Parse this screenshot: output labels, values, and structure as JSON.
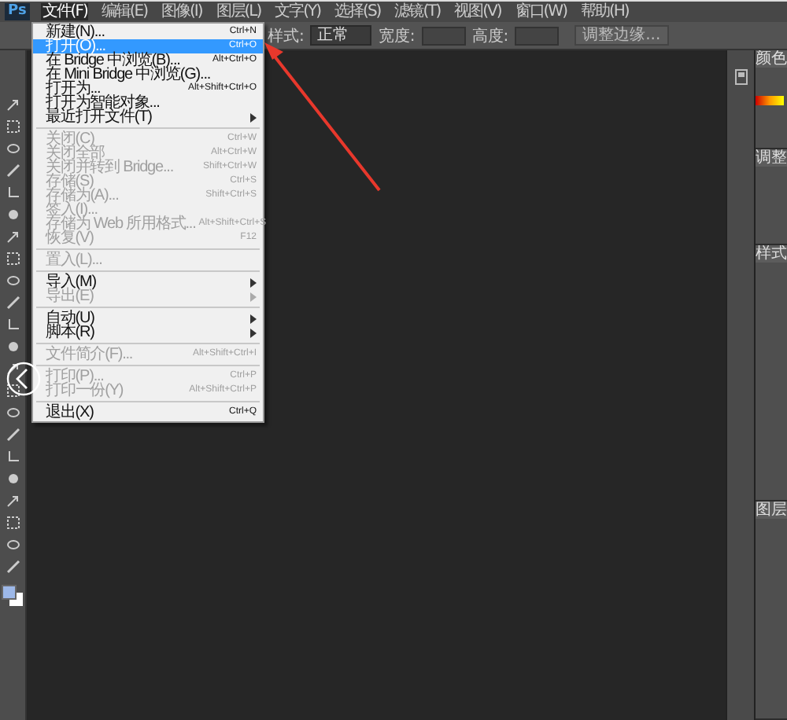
{
  "app_logo": "Ps",
  "menu_bar": [
    {
      "label": "文件(F)",
      "selected": true
    },
    {
      "label": "编辑(E)",
      "selected": false
    },
    {
      "label": "图像(I)",
      "selected": false
    },
    {
      "label": "图层(L)",
      "selected": false
    },
    {
      "label": "文字(Y)",
      "selected": false
    },
    {
      "label": "选择(S)",
      "selected": false
    },
    {
      "label": "滤镜(T)",
      "selected": false
    },
    {
      "label": "视图(V)",
      "selected": false
    },
    {
      "label": "窗口(W)",
      "selected": false
    },
    {
      "label": "帮助(H)",
      "selected": false
    }
  ],
  "options_bar": {
    "style_label": "样式:",
    "style_value": "正常",
    "width_label": "宽度:",
    "height_label": "高度:",
    "refine_button": "调整边缘..."
  },
  "file_menu": [
    {
      "kind": "item",
      "label": "新建(N)...",
      "shortcut": "Ctrl+N",
      "disabled": false,
      "selected": false
    },
    {
      "kind": "item",
      "label": "打开(O)...",
      "shortcut": "Ctrl+O",
      "disabled": false,
      "selected": true
    },
    {
      "kind": "item",
      "label": "在 Bridge 中浏览(B)...",
      "shortcut": "Alt+Ctrl+O",
      "disabled": false,
      "selected": false
    },
    {
      "kind": "item",
      "label": "在 Mini Bridge 中浏览(G)...",
      "disabled": false,
      "selected": false
    },
    {
      "kind": "item",
      "label": "打开为...",
      "shortcut": "Alt+Shift+Ctrl+O",
      "disabled": false,
      "selected": false
    },
    {
      "kind": "item",
      "label": "打开为智能对象...",
      "disabled": false,
      "selected": false
    },
    {
      "kind": "submenu",
      "label": "最近打开文件(T)",
      "disabled": false,
      "selected": false
    },
    {
      "kind": "separator"
    },
    {
      "kind": "item",
      "label": "关闭(C)",
      "shortcut": "Ctrl+W",
      "disabled": true,
      "selected": false
    },
    {
      "kind": "item",
      "label": "关闭全部",
      "shortcut": "Alt+Ctrl+W",
      "disabled": true,
      "selected": false
    },
    {
      "kind": "item",
      "label": "关闭并转到 Bridge...",
      "shortcut": "Shift+Ctrl+W",
      "disabled": true,
      "selected": false
    },
    {
      "kind": "item",
      "label": "存储(S)",
      "shortcut": "Ctrl+S",
      "disabled": true,
      "selected": false
    },
    {
      "kind": "item",
      "label": "存储为(A)...",
      "shortcut": "Shift+Ctrl+S",
      "disabled": true,
      "selected": false
    },
    {
      "kind": "item",
      "label": "签入(I)...",
      "disabled": true,
      "selected": false
    },
    {
      "kind": "item",
      "label": "存储为 Web 所用格式...",
      "shortcut": "Alt+Shift+Ctrl+S",
      "disabled": true,
      "selected": false
    },
    {
      "kind": "item",
      "label": "恢复(V)",
      "shortcut": "F12",
      "disabled": true,
      "selected": false
    },
    {
      "kind": "separator"
    },
    {
      "kind": "item",
      "label": "置入(L)...",
      "disabled": true,
      "selected": false
    },
    {
      "kind": "separator"
    },
    {
      "kind": "submenu",
      "label": "导入(M)",
      "disabled": false,
      "selected": false
    },
    {
      "kind": "submenu",
      "label": "导出(E)",
      "disabled": true,
      "selected": false
    },
    {
      "kind": "separator"
    },
    {
      "kind": "submenu",
      "label": "自动(U)",
      "disabled": false,
      "selected": false
    },
    {
      "kind": "submenu",
      "label": "脚本(R)",
      "disabled": false,
      "selected": false
    },
    {
      "kind": "separator"
    },
    {
      "kind": "item",
      "label": "文件简介(F)...",
      "shortcut": "Alt+Shift+Ctrl+I",
      "disabled": true,
      "selected": false
    },
    {
      "kind": "separator"
    },
    {
      "kind": "item",
      "label": "打印(P)...",
      "shortcut": "Ctrl+P",
      "disabled": true,
      "selected": false
    },
    {
      "kind": "item",
      "label": "打印一份(Y)",
      "shortcut": "Alt+Shift+Ctrl+P",
      "disabled": true,
      "selected": false
    },
    {
      "kind": "separator"
    },
    {
      "kind": "item",
      "label": "退出(X)",
      "shortcut": "Ctrl+Q",
      "disabled": false,
      "selected": false
    }
  ],
  "panels": [
    {
      "tab": "颜色"
    },
    {
      "tab": "调整"
    },
    {
      "tab": "样式"
    },
    {
      "tab": "图层"
    }
  ]
}
